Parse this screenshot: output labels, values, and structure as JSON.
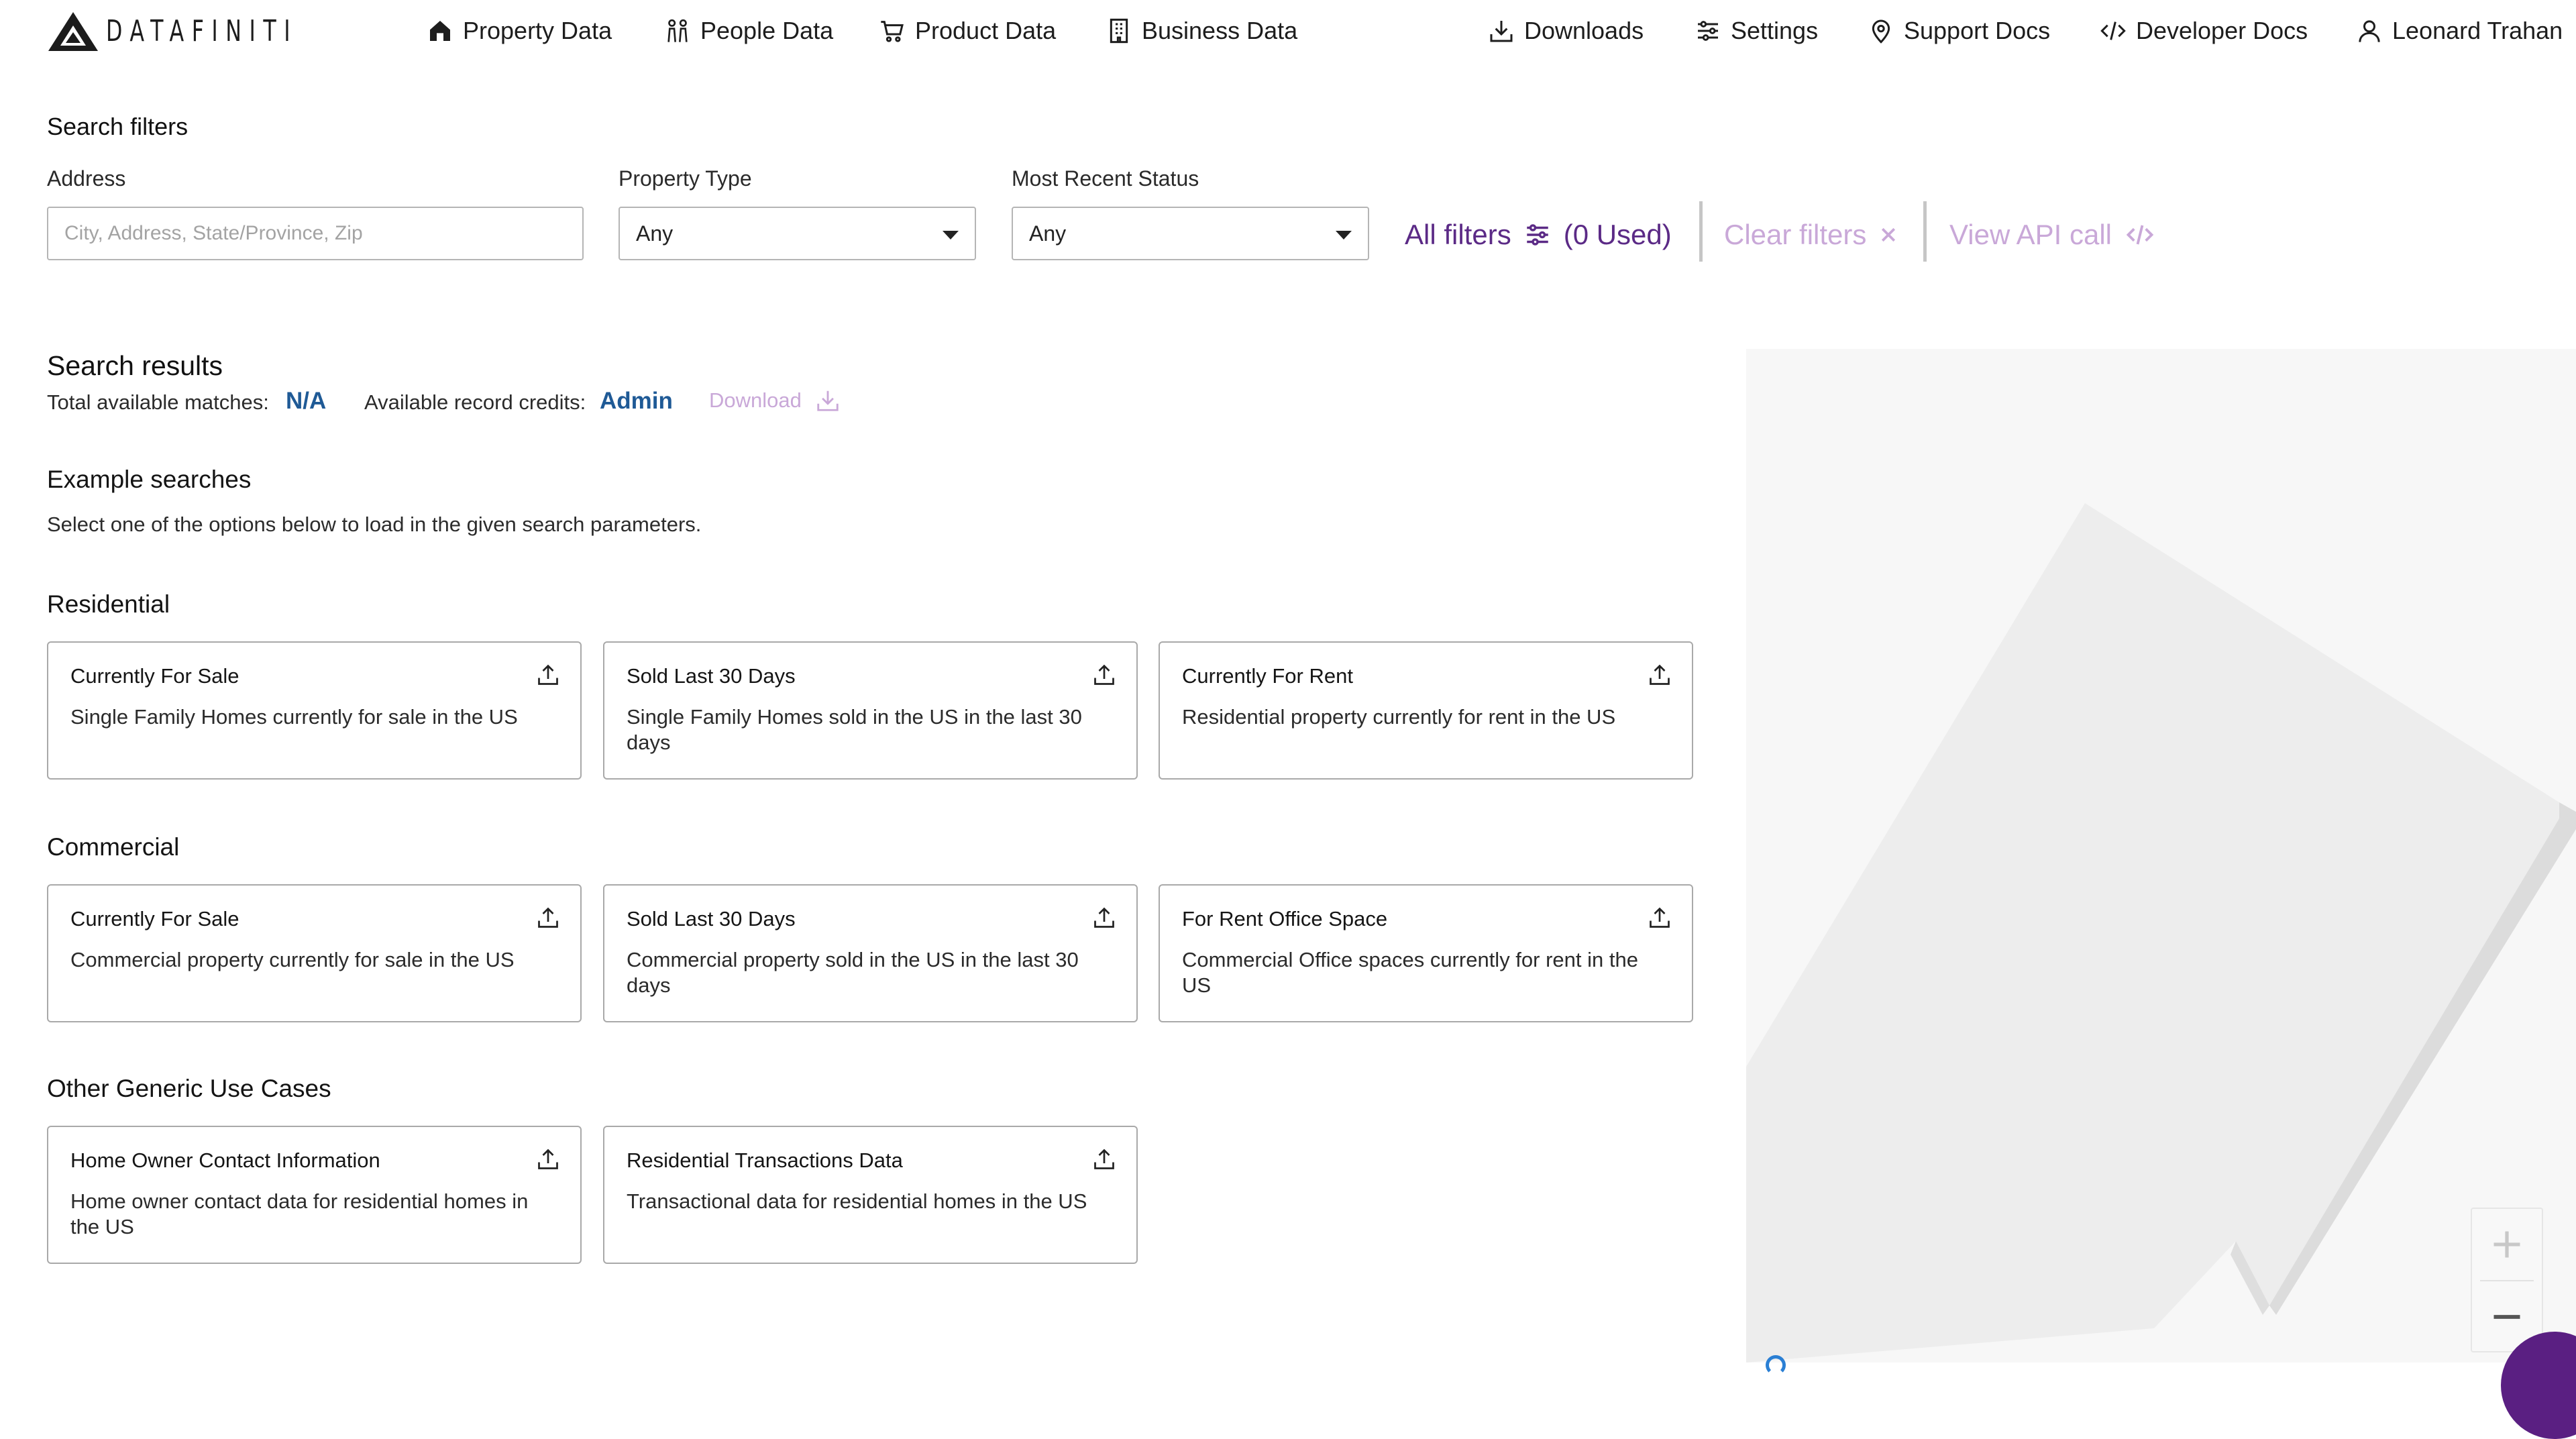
{
  "brand": {
    "name": "DATAFINITI"
  },
  "nav": {
    "left": [
      {
        "label": "Property Data",
        "icon": "home-icon"
      },
      {
        "label": "People Data",
        "icon": "people-icon"
      },
      {
        "label": "Product Data",
        "icon": "cart-icon"
      },
      {
        "label": "Business Data",
        "icon": "building-icon"
      }
    ],
    "right": [
      {
        "label": "Downloads",
        "icon": "download-icon"
      },
      {
        "label": "Settings",
        "icon": "sliders-icon"
      },
      {
        "label": "Support Docs",
        "icon": "location-pin-icon"
      },
      {
        "label": "Developer Docs",
        "icon": "code-icon"
      },
      {
        "label": "Leonard Trahan",
        "icon": "user-icon"
      }
    ]
  },
  "filters": {
    "title": "Search filters",
    "address": {
      "label": "Address",
      "placeholder": "City, Address, State/Province, Zip",
      "value": ""
    },
    "property_type": {
      "label": "Property Type",
      "value": "Any"
    },
    "status": {
      "label": "Most Recent Status",
      "value": "Any"
    },
    "all_filters": {
      "label": "All filters",
      "used": "(0 Used)"
    },
    "clear": {
      "label": "Clear filters"
    },
    "api": {
      "label": "View API call"
    }
  },
  "results": {
    "title": "Search results",
    "matches_label": "Total available matches:",
    "matches_value": "N/A",
    "credits_label": "Available record credits:",
    "credits_value": "Admin",
    "download_label": "Download"
  },
  "examples": {
    "title": "Example searches",
    "helper": "Select one of the options below to load in the given search parameters.",
    "groups": [
      {
        "title": "Residential",
        "cards": [
          {
            "title": "Currently For Sale",
            "desc": "Single Family Homes currently for sale in the US"
          },
          {
            "title": "Sold Last 30 Days",
            "desc": "Single Family Homes sold in the US in the last 30 days"
          },
          {
            "title": "Currently For Rent",
            "desc": "Residential property currently for rent in the US"
          }
        ]
      },
      {
        "title": "Commercial",
        "cards": [
          {
            "title": "Currently For Sale",
            "desc": "Commercial property currently for sale in the US"
          },
          {
            "title": "Sold Last 30 Days",
            "desc": "Commercial property sold in the US in the last 30 days"
          },
          {
            "title": "For Rent Office Space",
            "desc": "Commercial Office spaces currently for rent in the US"
          }
        ]
      },
      {
        "title": "Other Generic Use Cases",
        "cards": [
          {
            "title": "Home Owner Contact Information",
            "desc": "Home owner contact data for residential homes in the US"
          },
          {
            "title": "Residential Transactions Data",
            "desc": "Transactional data for residential homes in the US"
          }
        ]
      }
    ]
  },
  "colors": {
    "accent": "#5b2a86",
    "accent_light": "#c9a8d8",
    "link_blue": "#1f5a96"
  }
}
